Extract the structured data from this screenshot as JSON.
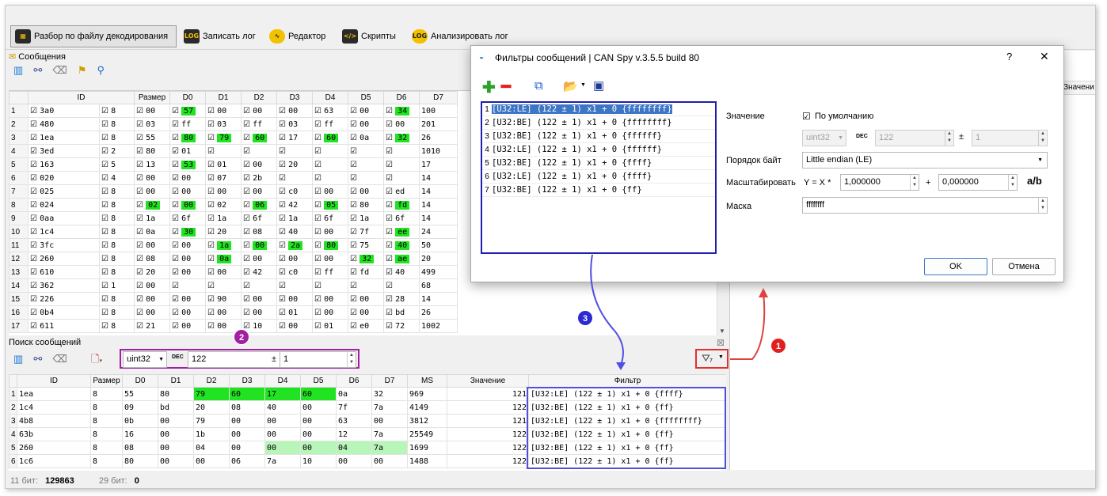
{
  "toolbar": {
    "items": [
      {
        "label": "Разбор по файлу декодирования",
        "icon": "decode-file-icon",
        "active": true
      },
      {
        "label": "Записать лог",
        "icon": "log-record-icon"
      },
      {
        "label": "Редактор",
        "icon": "editor-icon"
      },
      {
        "label": "Скрипты",
        "icon": "script-icon"
      },
      {
        "label": "Анализировать лог",
        "icon": "log-analyze-icon"
      }
    ]
  },
  "messages": {
    "title": "Сообщения",
    "columns": [
      "ID",
      "Размер",
      "D0",
      "D1",
      "D2",
      "D3",
      "D4",
      "D5",
      "D6",
      "D7",
      "MS"
    ],
    "rows": [
      {
        "n": "1",
        "id": "3a0",
        "size": "8",
        "d": [
          "00",
          "57",
          "00",
          "00",
          "00",
          "63",
          "00",
          "34"
        ],
        "ms": "100",
        "hl": [
          0,
          1,
          0,
          0,
          0,
          0,
          0,
          1
        ]
      },
      {
        "n": "2",
        "id": "480",
        "size": "8",
        "d": [
          "03",
          "ff",
          "03",
          "ff",
          "03",
          "ff",
          "00",
          "00"
        ],
        "ms": "201",
        "hl": [
          0,
          0,
          0,
          0,
          0,
          0,
          0,
          0
        ]
      },
      {
        "n": "3",
        "id": "1ea",
        "size": "8",
        "d": [
          "55",
          "80",
          "79",
          "60",
          "17",
          "60",
          "0a",
          "32"
        ],
        "ms": "26",
        "hl": [
          0,
          1,
          1,
          1,
          0,
          1,
          0,
          1
        ]
      },
      {
        "n": "4",
        "id": "3ed",
        "size": "2",
        "d": [
          "80",
          "01",
          "",
          "",
          "",
          "",
          "",
          ""
        ],
        "ms": "1010",
        "hl": [
          0,
          0,
          0,
          0,
          0,
          0,
          0,
          0
        ]
      },
      {
        "n": "5",
        "id": "163",
        "size": "5",
        "d": [
          "13",
          "53",
          "01",
          "00",
          "20",
          "",
          "",
          ""
        ],
        "ms": "17",
        "hl": [
          0,
          1,
          0,
          0,
          0,
          0,
          0,
          0
        ]
      },
      {
        "n": "6",
        "id": "020",
        "size": "4",
        "d": [
          "00",
          "00",
          "07",
          "2b",
          "",
          "",
          "",
          ""
        ],
        "ms": "14",
        "hl": [
          0,
          0,
          0,
          0,
          0,
          0,
          0,
          0
        ]
      },
      {
        "n": "7",
        "id": "025",
        "size": "8",
        "d": [
          "00",
          "00",
          "00",
          "00",
          "c0",
          "00",
          "00",
          "ed"
        ],
        "ms": "14",
        "hl": [
          0,
          0,
          0,
          0,
          0,
          0,
          0,
          0
        ]
      },
      {
        "n": "8",
        "id": "024",
        "size": "8",
        "d": [
          "02",
          "00",
          "02",
          "06",
          "42",
          "05",
          "80",
          "fd"
        ],
        "ms": "14",
        "hl": [
          1,
          1,
          0,
          1,
          0,
          1,
          0,
          1
        ]
      },
      {
        "n": "9",
        "id": "0aa",
        "size": "8",
        "d": [
          "1a",
          "6f",
          "1a",
          "6f",
          "1a",
          "6f",
          "1a",
          "6f"
        ],
        "ms": "14",
        "hl": [
          0,
          0,
          0,
          0,
          0,
          0,
          0,
          0
        ]
      },
      {
        "n": "10",
        "id": "1c4",
        "size": "8",
        "d": [
          "0a",
          "30",
          "20",
          "08",
          "40",
          "00",
          "7f",
          "ee"
        ],
        "ms": "24",
        "hl": [
          0,
          1,
          0,
          0,
          0,
          0,
          0,
          1
        ]
      },
      {
        "n": "11",
        "id": "3fc",
        "size": "8",
        "d": [
          "00",
          "00",
          "1a",
          "00",
          "2a",
          "80",
          "75",
          "40"
        ],
        "ms": "50",
        "hl": [
          0,
          0,
          1,
          1,
          1,
          1,
          0,
          1
        ]
      },
      {
        "n": "12",
        "id": "260",
        "size": "8",
        "d": [
          "08",
          "00",
          "0a",
          "00",
          "00",
          "00",
          "32",
          "ae"
        ],
        "ms": "20",
        "hl": [
          0,
          0,
          1,
          0,
          0,
          0,
          1,
          1
        ]
      },
      {
        "n": "13",
        "id": "610",
        "size": "8",
        "d": [
          "20",
          "00",
          "00",
          "42",
          "c0",
          "ff",
          "fd",
          "40"
        ],
        "ms": "499",
        "hl": [
          0,
          0,
          0,
          0,
          0,
          0,
          0,
          0
        ]
      },
      {
        "n": "14",
        "id": "362",
        "size": "1",
        "d": [
          "00",
          "",
          "",
          "",
          "",
          "",
          "",
          ""
        ],
        "ms": "68",
        "hl": [
          0,
          0,
          0,
          0,
          0,
          0,
          0,
          0
        ]
      },
      {
        "n": "15",
        "id": "226",
        "size": "8",
        "d": [
          "00",
          "00",
          "90",
          "00",
          "00",
          "00",
          "00",
          "28"
        ],
        "ms": "14",
        "hl": [
          0,
          0,
          0,
          0,
          0,
          0,
          0,
          0
        ]
      },
      {
        "n": "16",
        "id": "0b4",
        "size": "8",
        "d": [
          "00",
          "00",
          "00",
          "00",
          "01",
          "00",
          "00",
          "bd"
        ],
        "ms": "26",
        "hl": [
          0,
          0,
          0,
          0,
          0,
          0,
          0,
          0
        ]
      },
      {
        "n": "17",
        "id": "611",
        "size": "8",
        "d": [
          "21",
          "00",
          "00",
          "10",
          "00",
          "01",
          "e0",
          "72"
        ],
        "ms": "1002",
        "hl": [
          0,
          0,
          0,
          0,
          0,
          0,
          0,
          0
        ]
      }
    ]
  },
  "search": {
    "title": "Поиск сообщений",
    "type": "uint32",
    "dec": "DEC",
    "value": "122",
    "pm": "±",
    "tol": "1",
    "filter_count": "7",
    "columns": [
      "ID",
      "Размер",
      "D0",
      "D1",
      "D2",
      "D3",
      "D4",
      "D5",
      "D6",
      "D7",
      "MS",
      "Значение",
      "Фильтр"
    ],
    "rows": [
      {
        "n": "1",
        "id": "1ea",
        "size": "8",
        "d": [
          "55",
          "80",
          "79",
          "60",
          "17",
          "60",
          "0a",
          "32"
        ],
        "ms": "969",
        "val": "121",
        "flt": "[U32:LE] (122 ± 1) x1 + 0 {ffff}",
        "hl": [
          0,
          0,
          1,
          1,
          1,
          1,
          0,
          0
        ]
      },
      {
        "n": "2",
        "id": "1c4",
        "size": "8",
        "d": [
          "09",
          "bd",
          "20",
          "08",
          "40",
          "00",
          "7f",
          "7a"
        ],
        "ms": "4149",
        "val": "122",
        "flt": "[U32:BE] (122 ± 1) x1 + 0 {ff}",
        "hl": [
          0,
          0,
          0,
          0,
          0,
          0,
          0,
          0
        ]
      },
      {
        "n": "3",
        "id": "4b8",
        "size": "8",
        "d": [
          "0b",
          "00",
          "79",
          "00",
          "00",
          "00",
          "63",
          "00"
        ],
        "ms": "3812",
        "val": "121",
        "flt": "[U32:LE] (122 ± 1) x1 + 0 {ffffffff}",
        "hl": [
          0,
          0,
          0,
          0,
          0,
          0,
          0,
          0
        ]
      },
      {
        "n": "4",
        "id": "63b",
        "size": "8",
        "d": [
          "16",
          "00",
          "1b",
          "00",
          "00",
          "00",
          "12",
          "7a"
        ],
        "ms": "25549",
        "val": "122",
        "flt": "[U32:BE] (122 ± 1) x1 + 0 {ff}",
        "hl": [
          0,
          0,
          0,
          0,
          0,
          0,
          0,
          0
        ]
      },
      {
        "n": "5",
        "id": "260",
        "size": "8",
        "d": [
          "08",
          "00",
          "04",
          "00",
          "00",
          "00",
          "04",
          "7a"
        ],
        "ms": "1699",
        "val": "122",
        "flt": "[U32:BE] (122 ± 1) x1 + 0 {ff}",
        "hl": [
          0,
          0,
          0,
          0,
          2,
          2,
          2,
          2
        ]
      },
      {
        "n": "6",
        "id": "1c6",
        "size": "8",
        "d": [
          "80",
          "00",
          "00",
          "06",
          "7a",
          "10",
          "00",
          "00"
        ],
        "ms": "1488",
        "val": "122",
        "flt": "[U32:BE] (122 ± 1) x1 + 0 {ff}",
        "hl": [
          0,
          0,
          0,
          0,
          0,
          0,
          0,
          0
        ]
      }
    ]
  },
  "status": {
    "a_label": "11 бит:",
    "a_value": "129863",
    "b_label": "29 бит:",
    "b_value": "0"
  },
  "right_header": "Значени",
  "dialog": {
    "title": "Фильтры сообщений | CAN Spy v.3.5.5 build 80",
    "help": "?",
    "close": "✕",
    "filters": [
      "[U32:LE] (122 ± 1) x1 + 0 {ffffffff}",
      "[U32:BE] (122 ± 1) x1 + 0 {ffffffff}",
      "[U32:BE] (122 ± 1) x1 + 0 {ffffff}",
      "[U32:LE] (122 ± 1) x1 + 0 {ffffff}",
      "[U32:BE] (122 ± 1) x1 + 0 {ffff}",
      "[U32:LE] (122 ± 1) x1 + 0 {ffff}",
      "[U32:BE] (122 ± 1) x1 + 0 {ff}"
    ],
    "value_label": "Значение",
    "default_label": "По умолчанию",
    "type": "uint32",
    "dec": "DEC",
    "value": "122",
    "pm": "±",
    "tol": "1",
    "byte_order_label": "Порядок байт",
    "byte_order": "Little endian (LE)",
    "scale_label": "Масштабировать",
    "scale_eq": "Y = X *",
    "scale": "1,000000",
    "plus": "+",
    "offset": "0,000000",
    "ab": "a/b",
    "mask_label": "Маска",
    "mask": "ffffffff",
    "ok": "OK",
    "cancel": "Отмена"
  },
  "markers": [
    "1",
    "2",
    "3"
  ],
  "colors": {
    "highlight": "#21e321",
    "highlight_light": "#b8f5b8",
    "selection": "#3c76c4",
    "blue_frame": "#1f1faf",
    "purple_frame": "#a21fa2",
    "red_frame": "#e03030",
    "arrow_blue": "#5050e0",
    "arrow_red": "#e04040"
  }
}
